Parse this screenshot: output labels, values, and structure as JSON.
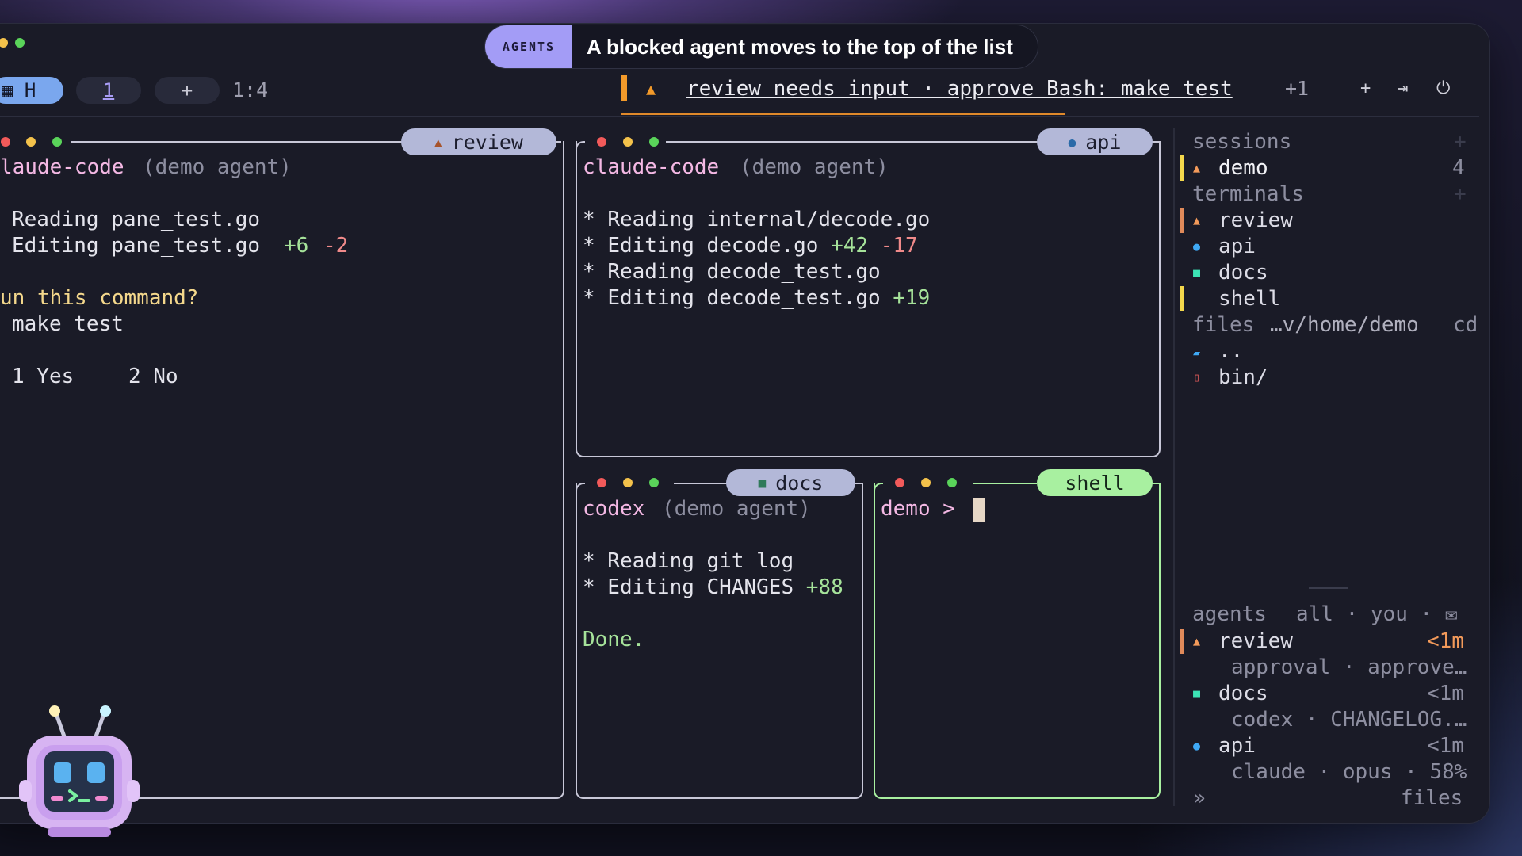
{
  "callout": {
    "badge": "AGENTS",
    "message": "A blocked agent moves to the top of the list"
  },
  "tabbar": {
    "home_tab": "▦ H",
    "active_tab": "1",
    "new_tab": "+",
    "position": "1:4",
    "alert_text": "review needs input · approve Bash: make test",
    "alert_more": "+1",
    "icons": [
      "plus-icon",
      "exit-icon",
      "power-icon"
    ]
  },
  "pane_review": {
    "title": "review",
    "lines": [
      "laude-code",
      "(demo agent)",
      "Reading pane_test.go",
      "Editing pane_test.go",
      "+6",
      "-2",
      "un this command?",
      "make test",
      "1 Yes",
      "2 No"
    ]
  },
  "pane_api": {
    "title": "api",
    "agent": "claude-code",
    "agent_note": "(demo agent)",
    "lines": [
      {
        "prefix": "* ",
        "text": "Reading internal/decode.go",
        "add": "",
        "del": ""
      },
      {
        "prefix": "* ",
        "text": "Editing decode.go",
        "add": "+42",
        "del": "-17"
      },
      {
        "prefix": "* ",
        "text": "Reading decode_test.go",
        "add": "",
        "del": ""
      },
      {
        "prefix": "* ",
        "text": "Editing decode_test.go",
        "add": "+19",
        "del": ""
      }
    ]
  },
  "pane_docs": {
    "title": "docs",
    "agent": "codex",
    "agent_note": "(demo agent)",
    "line1": "* Reading git log",
    "line2": "* Editing CHANGES",
    "line2_add": "+88",
    "done": "Done."
  },
  "pane_shell": {
    "title": "shell",
    "prompt": "demo >"
  },
  "sidebar": {
    "sessions_header": "sessions",
    "session_name": "demo",
    "session_count": "4",
    "terminals_header": "terminals",
    "terminals": [
      "review",
      "api",
      "docs",
      "shell"
    ],
    "files_header": "files",
    "files_path": "…v/home/demo",
    "files_cd": "cd",
    "files": [
      "..",
      "bin/"
    ],
    "agents_header": "agents",
    "agents_filters": "all · you · ✉",
    "agents": [
      {
        "name": "review",
        "time": "<1m",
        "detail": "approval · approve…"
      },
      {
        "name": "docs",
        "time": "<1m",
        "detail": "codex · CHANGELOG.…"
      },
      {
        "name": "api",
        "time": "<1m",
        "detail": "claude · opus · 58%"
      }
    ],
    "footer_chevron": "»",
    "footer_label": "files"
  },
  "colors": {
    "accent": "#a39cf6",
    "warn": "#f39a2a",
    "api_blue": "#3fa9f5",
    "docs_green": "#3ce3b4",
    "shell_green": "#a8f0a0"
  }
}
